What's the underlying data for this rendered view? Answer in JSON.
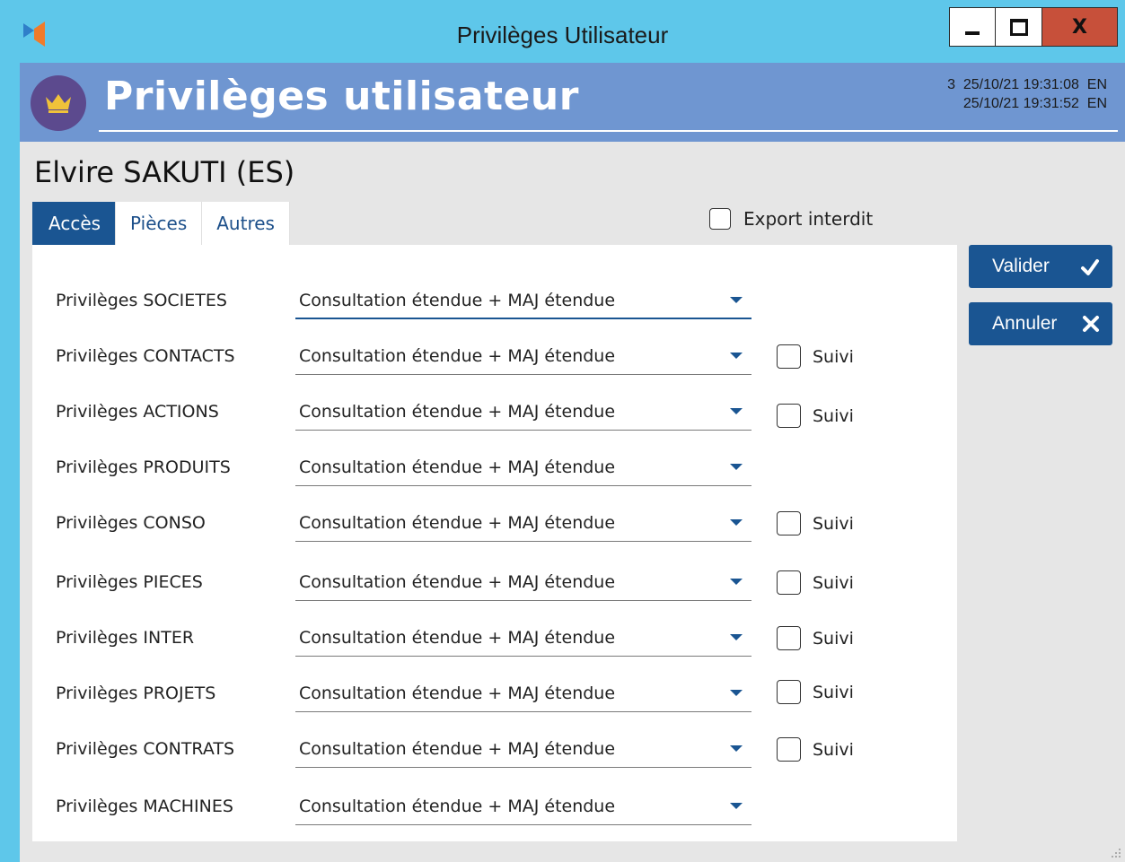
{
  "window": {
    "title": "Privilèges Utilisateur",
    "close_glyph": "X"
  },
  "header": {
    "title": "Privilèges utilisateur",
    "icon": "crown-icon",
    "info_line1": "3  25/10/21 19:31:08  EN",
    "info_line2": "25/10/21 19:31:52  EN"
  },
  "user": {
    "name": "Elvire SAKUTI (ES)"
  },
  "tabs": [
    {
      "label": "Accès",
      "active": true
    },
    {
      "label": "Pièces",
      "active": false
    },
    {
      "label": "Autres",
      "active": false
    }
  ],
  "export_interdit": {
    "label": "Export interdit",
    "checked": false
  },
  "rows": [
    {
      "label": "Privilèges SOCIETES",
      "value": "Consultation étendue + MAJ étendue",
      "has_suivi": false
    },
    {
      "label": "Privilèges CONTACTS",
      "value": "Consultation étendue + MAJ étendue",
      "has_suivi": true,
      "suivi_label": "Suivi",
      "suivi_checked": false
    },
    {
      "label": "Privilèges ACTIONS",
      "value": "Consultation étendue + MAJ étendue",
      "has_suivi": true,
      "suivi_label": "Suivi",
      "suivi_checked": false
    },
    {
      "label": "Privilèges PRODUITS",
      "value": "Consultation étendue + MAJ étendue",
      "has_suivi": false
    },
    {
      "label": "Privilèges CONSO",
      "value": "Consultation étendue + MAJ étendue",
      "has_suivi": true,
      "suivi_label": "Suivi",
      "suivi_checked": false
    },
    {
      "label": "Privilèges PIECES",
      "value": "Consultation étendue + MAJ étendue",
      "has_suivi": true,
      "suivi_label": "Suivi",
      "suivi_checked": false
    },
    {
      "label": "Privilèges INTER",
      "value": "Consultation étendue + MAJ étendue",
      "has_suivi": true,
      "suivi_label": "Suivi",
      "suivi_checked": false
    },
    {
      "label": "Privilèges PROJETS",
      "value": "Consultation étendue + MAJ étendue",
      "has_suivi": true,
      "suivi_label": "Suivi",
      "suivi_checked": false
    },
    {
      "label": "Privilèges CONTRATS",
      "value": "Consultation étendue + MAJ étendue",
      "has_suivi": true,
      "suivi_label": "Suivi",
      "suivi_checked": false
    },
    {
      "label": "Privilèges MACHINES",
      "value": "Consultation étendue + MAJ étendue",
      "has_suivi": false
    }
  ],
  "actions": {
    "validate_label": "Valider",
    "validate_icon": "check-icon",
    "cancel_label": "Annuler",
    "cancel_icon": "close-icon"
  },
  "colors": {
    "titlebar": "#5ec7ea",
    "header": "#6f96d1",
    "accent": "#1a5592",
    "close_button": "#c7503a",
    "crown_circle": "#5c4a8e",
    "crown": "#f0c23a"
  }
}
